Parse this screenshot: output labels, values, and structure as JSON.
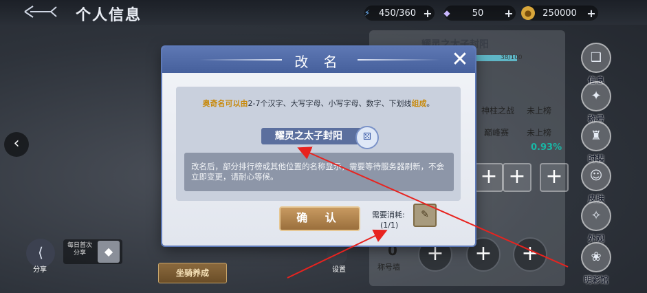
{
  "header": {
    "title": "个人信息",
    "resources": [
      {
        "icon": "lightning-icon",
        "value": "450/360"
      },
      {
        "icon": "diamond-icon",
        "value": "50"
      },
      {
        "icon": "coin-icon",
        "value": "250000"
      }
    ]
  },
  "profile": {
    "name": "耀灵之太子封阳",
    "exp": "38/100",
    "ranks": [
      {
        "name": "神柱之战",
        "status": "未上榜"
      },
      {
        "name": "巅峰赛",
        "status": "未上榜"
      }
    ],
    "percent": "0.93%"
  },
  "side_menu": [
    {
      "label": "信息",
      "icon": "book-icon"
    },
    {
      "label": "称号",
      "icon": "badge-icon"
    },
    {
      "label": "时装",
      "icon": "outfit-icon"
    },
    {
      "label": "皮肤",
      "icon": "skin-icon"
    },
    {
      "label": "外观",
      "icon": "appearance-icon"
    },
    {
      "label": "明彩馆",
      "icon": "gallery-icon"
    }
  ],
  "left": {
    "share_label": "分享",
    "daily_share": "每日首次分享",
    "mount_button": "坐骑养成",
    "bottom_label": "设置",
    "title_count": "0",
    "title_wall": "称号墙"
  },
  "dialog": {
    "title": "改 名",
    "close": "✕",
    "rule_prefix": "奥奇名可以由",
    "rule_body": "2-7个汉字、大写字母、小写字母、数字、下划线",
    "rule_suffix": "组成",
    "rule_end": "。",
    "name_value": "耀灵之太子封阳",
    "notice": "改名后，部分排行榜或其他位置的名称显示，需要等待服务器刷新，不会立即变更，请耐心等候。",
    "confirm_label": "确 认",
    "cost_label": "需要消耗:",
    "cost_count": "(1/1)"
  }
}
